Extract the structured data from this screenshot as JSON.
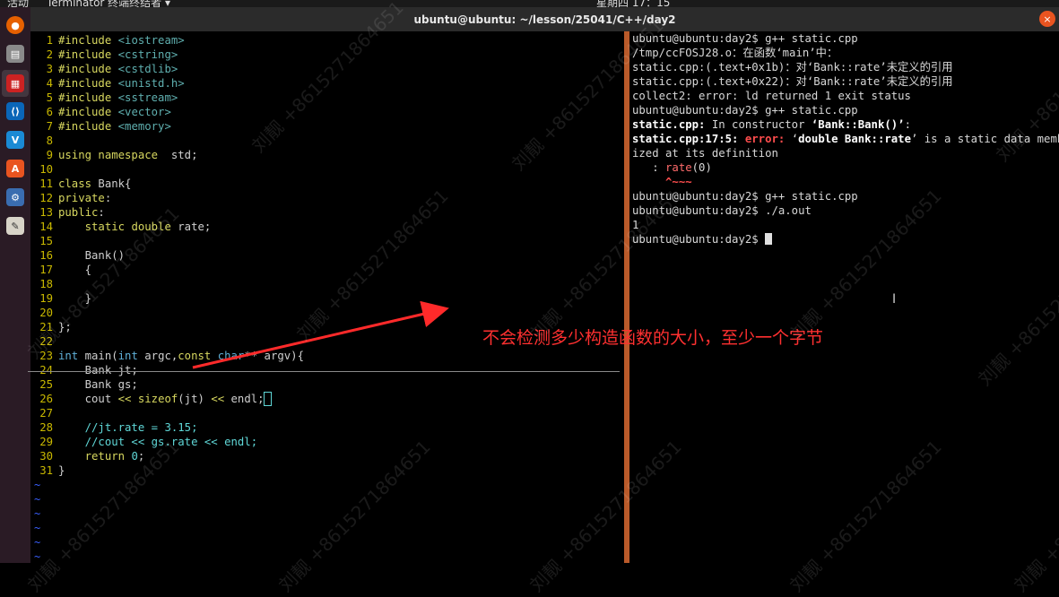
{
  "topbar": {
    "activities": "活动",
    "app": "Terminator 终端终结者 ▾",
    "clock": "星期四 17：15"
  },
  "window": {
    "title": "ubuntu@ubuntu: ~/lesson/25041/C++/day2",
    "close": "×"
  },
  "dock_icons": [
    "firefox-icon",
    "files-icon",
    "terminator-icon",
    "vscode-icon",
    "vscode-insiders-icon",
    "software-center-icon",
    "settings-icon",
    "text-editor-icon"
  ],
  "editor": {
    "lines": [
      {
        "n": "1",
        "p": [
          [
            "kw",
            "#include"
          ],
          [
            "hd",
            " <iostream>"
          ]
        ]
      },
      {
        "n": "2",
        "p": [
          [
            "kw",
            "#include"
          ],
          [
            "hd",
            " <cstring>"
          ]
        ]
      },
      {
        "n": "3",
        "p": [
          [
            "kw",
            "#include"
          ],
          [
            "hd",
            " <cstdlib>"
          ]
        ]
      },
      {
        "n": "4",
        "p": [
          [
            "kw",
            "#include"
          ],
          [
            "hd",
            " <unistd.h>"
          ]
        ]
      },
      {
        "n": "5",
        "p": [
          [
            "kw",
            "#include"
          ],
          [
            "hd",
            " <sstream>"
          ]
        ]
      },
      {
        "n": "6",
        "p": [
          [
            "kw",
            "#include"
          ],
          [
            "hd",
            " <vector>"
          ]
        ]
      },
      {
        "n": "7",
        "p": [
          [
            "kw",
            "#include"
          ],
          [
            "hd",
            " <memory>"
          ]
        ]
      },
      {
        "n": "8",
        "p": []
      },
      {
        "n": "9",
        "p": [
          [
            "kw",
            "using namespace"
          ],
          [
            "",
            "  std;"
          ]
        ]
      },
      {
        "n": "10",
        "p": []
      },
      {
        "n": "11",
        "p": [
          [
            "kw",
            "class"
          ],
          [
            "",
            " Bank{"
          ]
        ]
      },
      {
        "n": "12",
        "p": [
          [
            "kw",
            "private"
          ],
          [
            "",
            ":"
          ]
        ]
      },
      {
        "n": "13",
        "p": [
          [
            "kw",
            "public"
          ],
          [
            "",
            ":"
          ]
        ]
      },
      {
        "n": "14",
        "p": [
          [
            "",
            "    "
          ],
          [
            "kw",
            "static double"
          ],
          [
            "",
            " rate;"
          ]
        ]
      },
      {
        "n": "15",
        "p": []
      },
      {
        "n": "16",
        "p": [
          [
            "",
            "    Bank()"
          ]
        ]
      },
      {
        "n": "17",
        "p": [
          [
            "",
            "    {"
          ]
        ]
      },
      {
        "n": "18",
        "p": []
      },
      {
        "n": "19",
        "p": [
          [
            "",
            "    }"
          ]
        ]
      },
      {
        "n": "20",
        "p": []
      },
      {
        "n": "21",
        "p": [
          [
            "",
            "};"
          ]
        ]
      },
      {
        "n": "22",
        "p": []
      },
      {
        "n": "23",
        "p": [
          [
            "ty",
            "int"
          ],
          [
            "",
            " main("
          ],
          [
            "ty",
            "int"
          ],
          [
            "",
            " argc,"
          ],
          [
            "kw",
            "const"
          ],
          [
            " ty",
            " char"
          ],
          [
            "",
            "** argv){"
          ]
        ]
      },
      {
        "n": "24",
        "p": [
          [
            "",
            "    Bank jt;"
          ]
        ]
      },
      {
        "n": "25",
        "p": [
          [
            "",
            "    Bank gs;"
          ]
        ]
      },
      {
        "n": "26",
        "p": [
          [
            "",
            "    cout "
          ],
          [
            "kw",
            "<<"
          ],
          [
            " kw",
            " sizeof"
          ],
          [
            "",
            "(jt) "
          ],
          [
            "kw",
            "<<"
          ],
          [
            "",
            " endl;"
          ]
        ]
      },
      {
        "n": "27",
        "p": []
      },
      {
        "n": "28",
        "p": [
          [
            "cm",
            "    //jt.rate = 3.15;"
          ]
        ]
      },
      {
        "n": "29",
        "p": [
          [
            "cm",
            "    //cout << gs.rate << endl;"
          ]
        ]
      },
      {
        "n": "30",
        "p": [
          [
            "",
            "    "
          ],
          [
            "kw",
            "return"
          ],
          [
            "nm",
            " 0"
          ],
          [
            "",
            ";"
          ]
        ]
      },
      {
        "n": "31",
        "p": [
          [
            "",
            "}"
          ]
        ]
      }
    ],
    "tilde": "~"
  },
  "terminal": {
    "lines": [
      [
        [
          "",
          "ubuntu@ubuntu:day2$ g++ static.cpp"
        ]
      ],
      [
        [
          "",
          "/tmp/ccFOSJ28.o：在函数‘main’中："
        ]
      ],
      [
        [
          "",
          "static.cpp:(.text+0x1b)：对‘Bank::rate’未定义的引用"
        ]
      ],
      [
        [
          "",
          "static.cpp:(.text+0x22)：对‘Bank::rate’未定义的引用"
        ]
      ],
      [
        [
          "",
          "collect2: error: ld returned 1 exit status"
        ]
      ],
      [
        [
          "",
          "ubuntu@ubuntu:day2$ g++ static.cpp"
        ]
      ],
      [
        [
          "b",
          "static.cpp:"
        ],
        [
          "",
          " In constructor "
        ],
        [
          "b",
          "‘Bank::Bank()’"
        ],
        [
          "",
          ":"
        ]
      ],
      [
        [
          "b",
          "static.cpp:17:5:"
        ],
        [
          "",
          " "
        ],
        [
          "err",
          "error:"
        ],
        [
          "",
          " ‘"
        ],
        [
          "b",
          "double Bank::rate"
        ],
        [
          "",
          "’ is a static data membe"
        ]
      ],
      [
        [
          "",
          "ized at its definition"
        ]
      ],
      [
        [
          "",
          "   : "
        ],
        [
          "grn",
          "rate"
        ],
        [
          "",
          "(0)"
        ]
      ],
      [
        [
          "err",
          "     ^~~~"
        ]
      ],
      [
        [
          "",
          "ubuntu@ubuntu:day2$ g++ static.cpp"
        ]
      ],
      [
        [
          "",
          "ubuntu@ubuntu:day2$ ./a.out"
        ]
      ],
      [
        [
          "",
          "1"
        ]
      ],
      [
        [
          "",
          "ubuntu@ubuntu:day2$ "
        ]
      ]
    ]
  },
  "annotation": "不会检测多少构造函数的大小，至少一个字节",
  "watermark": "刘靓 +8615271864651",
  "colors": {
    "accent": "#e95420",
    "annotation": "#ff3030",
    "divider": "#b95a2a"
  }
}
